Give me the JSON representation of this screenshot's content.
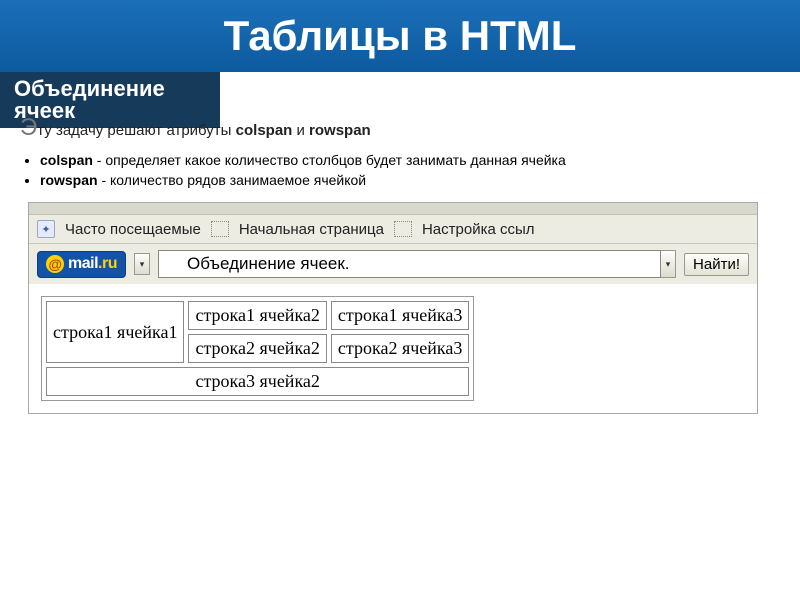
{
  "title": "Таблицы в HTML",
  "subtitle": "Объединение ячеек",
  "intro": {
    "prefix_cap": "Э",
    "text": "ту задачу решают атрибуты ",
    "kw1": "colspan",
    "and": " и ",
    "kw2": "rowspan"
  },
  "bullets": [
    {
      "kw": "colspan",
      "desc": "  - определяет какое количество столбцов будет занимать данная ячейка"
    },
    {
      "kw": "rowspan",
      "desc": "  - количество рядов занимаемое ячейкой"
    }
  ],
  "bookmarks": {
    "bm1": "Часто посещаемые",
    "bm2": "Начальная страница",
    "bm3": "Настройка ссыл"
  },
  "search": {
    "logo_mail": "mail",
    "logo_ru": ".ru",
    "value": "Объединение ячеек.",
    "find_label": "Найти!"
  },
  "table": {
    "r1c1": "строка1 ячейка1",
    "r1c2": "строка1 ячейка2",
    "r1c3": "строка1 ячейка3",
    "r2c2": "строка2 ячейка2",
    "r2c3": "строка2 ячейка3",
    "r3c2": "строка3 ячейка2"
  }
}
